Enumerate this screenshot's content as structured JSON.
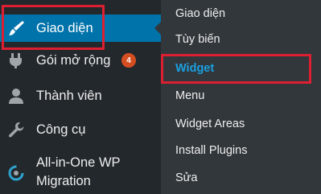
{
  "sidebar": {
    "items": [
      {
        "label": "Giao diện",
        "icon": "paintbrush-icon",
        "active": true
      },
      {
        "label": "Gói mở rộng",
        "icon": "plugin-icon",
        "badge": "4"
      },
      {
        "label": "Thành viên",
        "icon": "user-icon"
      },
      {
        "label": "Công cụ",
        "icon": "wrench-icon"
      },
      {
        "label_line1": "All-in-One WP",
        "label_line2": "Migration",
        "icon": "migration-icon"
      }
    ]
  },
  "submenu": {
    "items": [
      {
        "label": "Giao diện"
      },
      {
        "label": "Tùy biến"
      },
      {
        "label": "Widget",
        "current": true
      },
      {
        "label": "Menu"
      },
      {
        "label": "Widget Areas"
      },
      {
        "label": "Install Plugins"
      },
      {
        "label": "Sửa"
      }
    ]
  },
  "colors": {
    "sidebar_bg": "#23282d",
    "submenu_bg": "#32373c",
    "active_bg": "#0073aa",
    "current_text": "#1aa0e0",
    "badge_bg": "#d54e21",
    "highlight_border": "#dd1f32"
  }
}
